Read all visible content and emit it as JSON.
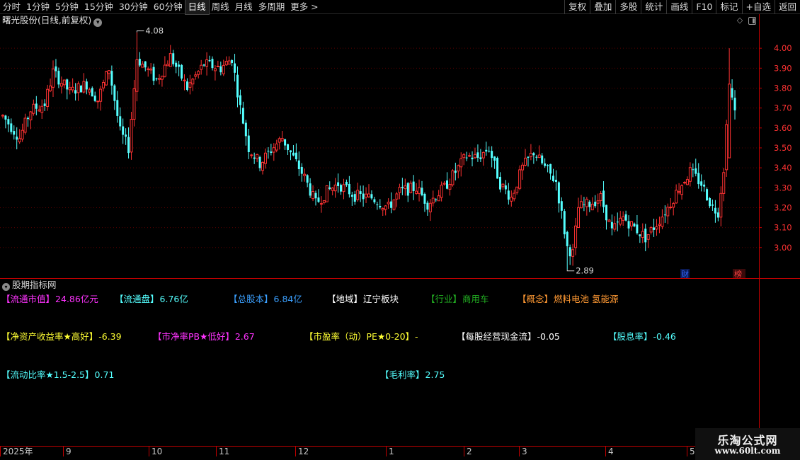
{
  "toolbar": {
    "periods": [
      "分时",
      "1分钟",
      "5分钟",
      "15分钟",
      "30分钟",
      "60分钟",
      "日线",
      "周线",
      "月线",
      "多周期",
      "更多 >"
    ],
    "active_period": "日线",
    "tools": [
      "复权",
      "叠加",
      "多股",
      "统计",
      "画线",
      "F10",
      "标记",
      "+自选",
      "返回"
    ]
  },
  "chart": {
    "title": "曙光股份(日线,前复权)",
    "high_label": "4.08",
    "low_label": "2.89",
    "badge_cai": "财",
    "badge_bang": "榜",
    "colors": {
      "up": "#ff3232",
      "down": "#54ffff",
      "grid": "#5a0000",
      "axis": "#c00000",
      "badge_cai": "#3366ff",
      "badge_bang": "#ff4444"
    }
  },
  "chart_data": {
    "type": "candlestick",
    "title": "曙光股份(日线,前复权)",
    "y_ticks": [
      "4.00",
      "3.90",
      "3.80",
      "3.70",
      "3.60",
      "3.50",
      "3.40",
      "3.30",
      "3.20",
      "3.10",
      "3.00"
    ],
    "ylim": [
      2.85,
      4.1
    ],
    "x_ticks": [
      "2025年",
      "9",
      "10",
      "11",
      "12",
      "1",
      "2",
      "3",
      "4",
      "5"
    ],
    "annotations": [
      {
        "text": "4.08",
        "kind": "period-high"
      },
      {
        "text": "2.89",
        "kind": "period-low"
      }
    ],
    "anchors": [
      [
        0,
        3.66
      ],
      [
        6,
        3.55
      ],
      [
        10,
        3.69
      ],
      [
        15,
        3.72
      ],
      [
        18,
        3.88
      ],
      [
        24,
        3.78
      ],
      [
        30,
        3.82
      ],
      [
        34,
        3.74
      ],
      [
        38,
        3.9
      ],
      [
        42,
        3.58
      ],
      [
        45,
        3.5
      ],
      [
        48,
        3.95
      ],
      [
        55,
        3.84
      ],
      [
        60,
        3.96
      ],
      [
        66,
        3.8
      ],
      [
        72,
        3.92
      ],
      [
        78,
        3.9
      ],
      [
        82,
        3.95
      ],
      [
        85,
        3.7
      ],
      [
        88,
        3.5
      ],
      [
        92,
        3.42
      ],
      [
        96,
        3.49
      ],
      [
        100,
        3.55
      ],
      [
        104,
        3.45
      ],
      [
        108,
        3.35
      ],
      [
        112,
        3.22
      ],
      [
        116,
        3.28
      ],
      [
        120,
        3.32
      ],
      [
        126,
        3.26
      ],
      [
        132,
        3.25
      ],
      [
        138,
        3.2
      ],
      [
        142,
        3.28
      ],
      [
        148,
        3.3
      ],
      [
        152,
        3.22
      ],
      [
        158,
        3.3
      ],
      [
        162,
        3.38
      ],
      [
        166,
        3.46
      ],
      [
        170,
        3.45
      ],
      [
        174,
        3.5
      ],
      [
        178,
        3.32
      ],
      [
        182,
        3.25
      ],
      [
        186,
        3.4
      ],
      [
        190,
        3.48
      ],
      [
        194,
        3.4
      ],
      [
        198,
        3.33
      ],
      [
        202,
        3.0
      ],
      [
        204,
        2.97
      ],
      [
        206,
        3.2
      ],
      [
        210,
        3.22
      ],
      [
        214,
        3.25
      ],
      [
        218,
        3.08
      ],
      [
        222,
        3.15
      ],
      [
        226,
        3.1
      ],
      [
        230,
        3.05
      ],
      [
        234,
        3.12
      ],
      [
        238,
        3.2
      ],
      [
        242,
        3.3
      ],
      [
        246,
        3.38
      ],
      [
        250,
        3.32
      ],
      [
        254,
        3.2
      ],
      [
        256,
        3.18
      ],
      [
        258,
        3.4
      ],
      [
        260,
        3.82
      ],
      [
        262,
        3.68
      ]
    ],
    "n_bars": 263
  },
  "indicator": {
    "header": "股期指标网",
    "metrics": [
      {
        "label": "流通市值",
        "value": "24.86亿元",
        "color": "#ff33ff"
      },
      {
        "label": "流通盘",
        "value": "6.76亿",
        "color": "#54ffff"
      },
      {
        "label": "总股本",
        "value": "6.84亿",
        "color": "#3ba0ff"
      },
      {
        "label": "地域",
        "value": "辽宁板块",
        "color": "#ffffff"
      },
      {
        "label": "行业",
        "value": "商用车",
        "color": "#22b022"
      },
      {
        "label": "概念",
        "value": "燃料电池 氢能源",
        "color": "#ff9933"
      },
      {
        "label": "净资产收益率★高好",
        "value": "-6.39",
        "color": "#ffff33"
      },
      {
        "label": "市净率PB★低好",
        "value": "2.67",
        "color": "#ff33ff"
      },
      {
        "label": "市盈率（动）PE★0-20",
        "value": "-",
        "color": "#ffff33"
      },
      {
        "label": "每股经营现金流",
        "value": "-0.05",
        "color": "#ffffff"
      },
      {
        "label": "股息率",
        "value": "-0.46",
        "color": "#54ffff"
      },
      {
        "label": "流动比率★1.5-2.5",
        "value": "0.71",
        "color": "#54ffff"
      },
      {
        "label": "毛利率",
        "value": "2.75",
        "color": "#54ffff"
      }
    ]
  },
  "watermark": {
    "text": "乐淘公式网",
    "url": "www.60lt.com"
  }
}
